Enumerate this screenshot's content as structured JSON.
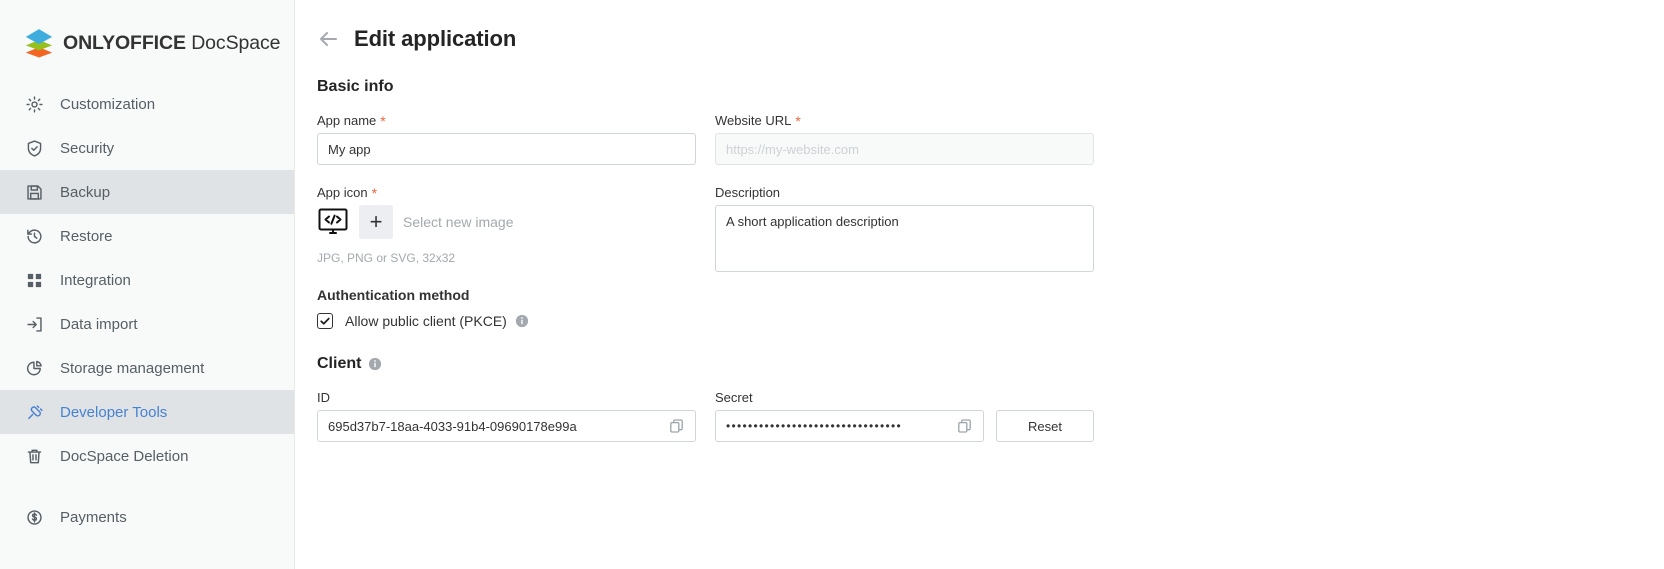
{
  "sidebar": {
    "logo": {
      "brand_bold": "ONLYOFFICE",
      "brand_light": "DocSpace"
    },
    "items": [
      {
        "label": "Customization",
        "icon": "gear-icon",
        "state": "default"
      },
      {
        "label": "Security",
        "icon": "shield-check-icon",
        "state": "default"
      },
      {
        "label": "Backup",
        "icon": "floppy-disk-icon",
        "state": "selected"
      },
      {
        "label": "Restore",
        "icon": "clock-rotate-left-icon",
        "state": "default"
      },
      {
        "label": "Integration",
        "icon": "grid-squares-icon",
        "state": "default"
      },
      {
        "label": "Data import",
        "icon": "import-arrow-icon",
        "state": "default"
      },
      {
        "label": "Storage management",
        "icon": "pie-chart-icon",
        "state": "default"
      },
      {
        "label": "Developer Tools",
        "icon": "plug-connector-icon",
        "state": "active"
      },
      {
        "label": "DocSpace Deletion",
        "icon": "trash-bin-icon",
        "state": "default"
      }
    ],
    "footer_items": [
      {
        "label": "Payments",
        "icon": "dollar-circle-icon",
        "state": "default"
      }
    ]
  },
  "header": {
    "back_icon": "arrow-left-icon",
    "title": "Edit application"
  },
  "basic_info": {
    "section_title": "Basic info",
    "app_name": {
      "label": "App name",
      "required_mark": "*",
      "value": "My app"
    },
    "website_url": {
      "label": "Website URL",
      "required_mark": "*",
      "placeholder": "https://my-website.com",
      "value": ""
    },
    "app_icon": {
      "label": "App icon",
      "required_mark": "*",
      "current_icon": "code-monitor-icon",
      "add_button_icon": "plus-icon",
      "select_label": "Select new image",
      "hint": "JPG, PNG or SVG, 32x32"
    },
    "description": {
      "label": "Description",
      "value": "A short application description"
    },
    "auth_method": {
      "label": "Authentication method",
      "checkbox_label": "Allow public client (PKCE)",
      "checked": true,
      "info_icon": "info-circle-icon"
    }
  },
  "client": {
    "section_title": "Client",
    "info_icon": "info-circle-icon",
    "id": {
      "label": "ID",
      "value": "695d37b7-18aa-4033-91b4-09690178e99a",
      "copy_icon": "copy-icon"
    },
    "secret": {
      "label": "Secret",
      "value": "••••••••••••••••••••••••••••••••",
      "copy_icon": "copy-icon"
    },
    "reset_button": "Reset"
  },
  "colors": {
    "accent_blue": "#4781d1",
    "required_red": "#f2633a",
    "sidebar_bg": "#f8f9f9",
    "selected_bg": "#e0e3e6",
    "text_dark": "#242424",
    "text_muted": "#a3a9ae"
  }
}
